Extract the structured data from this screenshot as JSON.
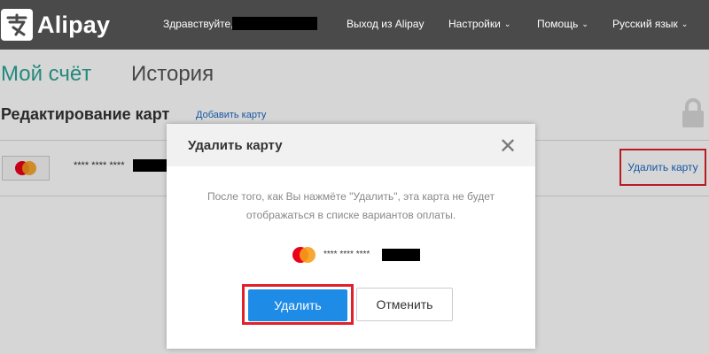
{
  "header": {
    "logo_text": "Alipay",
    "greeting": "Здравствуйте,",
    "logout": "Выход из Alipay",
    "settings": "Настройки",
    "help": "Помощь",
    "language": "Русский язык"
  },
  "tabs": {
    "account": "Мой счёт",
    "history": "История"
  },
  "section": {
    "title": "Редактирование карт",
    "add_card": "Добавить карту"
  },
  "card_row": {
    "masked_number": "**** **** ****",
    "delete_link": "Удалить карту"
  },
  "modal": {
    "title": "Удалить карту",
    "close": "✕",
    "message": "После того, как Вы нажмёте \"Удалить\", эта карта не будет отображаться в списке вариантов оплаты.",
    "masked_number": "**** **** ****",
    "delete_button": "Удалить",
    "cancel_button": "Отменить"
  },
  "colors": {
    "topbar": "#4a4a4a",
    "accent_teal": "#2aa595",
    "link_blue": "#1a66c2",
    "primary_button": "#1e8be6",
    "highlight_red": "#e0202a"
  }
}
